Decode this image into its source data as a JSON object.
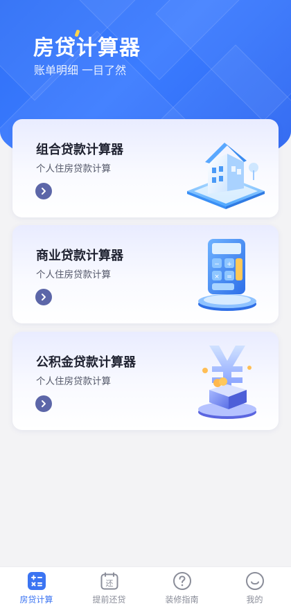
{
  "header": {
    "title": "房贷计算器",
    "subtitle": "账单明细 一目了然"
  },
  "cards": [
    {
      "title": "组合贷款计算器",
      "subtitle": "个人住房贷款计算",
      "icon": "house-icon"
    },
    {
      "title": "商业贷款计算器",
      "subtitle": "个人住房贷款计算",
      "icon": "calculator-icon"
    },
    {
      "title": "公积金贷款计算器",
      "subtitle": "个人住房贷款计算",
      "icon": "yuan-coin-icon"
    }
  ],
  "tabbar": {
    "items": [
      {
        "label": "房贷计算",
        "icon": "calculator-tab-icon",
        "active": true
      },
      {
        "label": "提前还贷",
        "icon": "calendar-repay-icon",
        "active": false
      },
      {
        "label": "装修指南",
        "icon": "question-circle-icon",
        "active": false
      },
      {
        "label": "我的",
        "icon": "smile-face-icon",
        "active": false
      }
    ]
  },
  "colors": {
    "brand": "#3b74f2",
    "arrow": "#5c66a8",
    "tab_inactive": "#8a8d99"
  }
}
